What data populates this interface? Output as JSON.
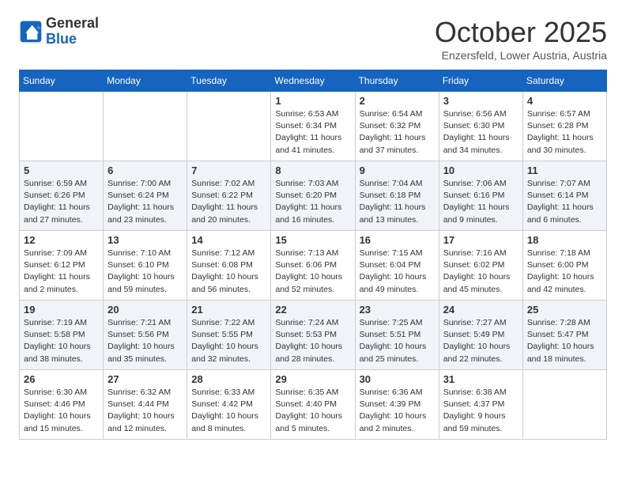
{
  "header": {
    "logo_general": "General",
    "logo_blue": "Blue",
    "month": "October 2025",
    "location": "Enzersfeld, Lower Austria, Austria"
  },
  "weekdays": [
    "Sunday",
    "Monday",
    "Tuesday",
    "Wednesday",
    "Thursday",
    "Friday",
    "Saturday"
  ],
  "weeks": [
    [
      {
        "day": "",
        "info": ""
      },
      {
        "day": "",
        "info": ""
      },
      {
        "day": "",
        "info": ""
      },
      {
        "day": "1",
        "info": "Sunrise: 6:53 AM\nSunset: 6:34 PM\nDaylight: 11 hours\nand 41 minutes."
      },
      {
        "day": "2",
        "info": "Sunrise: 6:54 AM\nSunset: 6:32 PM\nDaylight: 11 hours\nand 37 minutes."
      },
      {
        "day": "3",
        "info": "Sunrise: 6:56 AM\nSunset: 6:30 PM\nDaylight: 11 hours\nand 34 minutes."
      },
      {
        "day": "4",
        "info": "Sunrise: 6:57 AM\nSunset: 6:28 PM\nDaylight: 11 hours\nand 30 minutes."
      }
    ],
    [
      {
        "day": "5",
        "info": "Sunrise: 6:59 AM\nSunset: 6:26 PM\nDaylight: 11 hours\nand 27 minutes."
      },
      {
        "day": "6",
        "info": "Sunrise: 7:00 AM\nSunset: 6:24 PM\nDaylight: 11 hours\nand 23 minutes."
      },
      {
        "day": "7",
        "info": "Sunrise: 7:02 AM\nSunset: 6:22 PM\nDaylight: 11 hours\nand 20 minutes."
      },
      {
        "day": "8",
        "info": "Sunrise: 7:03 AM\nSunset: 6:20 PM\nDaylight: 11 hours\nand 16 minutes."
      },
      {
        "day": "9",
        "info": "Sunrise: 7:04 AM\nSunset: 6:18 PM\nDaylight: 11 hours\nand 13 minutes."
      },
      {
        "day": "10",
        "info": "Sunrise: 7:06 AM\nSunset: 6:16 PM\nDaylight: 11 hours\nand 9 minutes."
      },
      {
        "day": "11",
        "info": "Sunrise: 7:07 AM\nSunset: 6:14 PM\nDaylight: 11 hours\nand 6 minutes."
      }
    ],
    [
      {
        "day": "12",
        "info": "Sunrise: 7:09 AM\nSunset: 6:12 PM\nDaylight: 11 hours\nand 2 minutes."
      },
      {
        "day": "13",
        "info": "Sunrise: 7:10 AM\nSunset: 6:10 PM\nDaylight: 10 hours\nand 59 minutes."
      },
      {
        "day": "14",
        "info": "Sunrise: 7:12 AM\nSunset: 6:08 PM\nDaylight: 10 hours\nand 56 minutes."
      },
      {
        "day": "15",
        "info": "Sunrise: 7:13 AM\nSunset: 6:06 PM\nDaylight: 10 hours\nand 52 minutes."
      },
      {
        "day": "16",
        "info": "Sunrise: 7:15 AM\nSunset: 6:04 PM\nDaylight: 10 hours\nand 49 minutes."
      },
      {
        "day": "17",
        "info": "Sunrise: 7:16 AM\nSunset: 6:02 PM\nDaylight: 10 hours\nand 45 minutes."
      },
      {
        "day": "18",
        "info": "Sunrise: 7:18 AM\nSunset: 6:00 PM\nDaylight: 10 hours\nand 42 minutes."
      }
    ],
    [
      {
        "day": "19",
        "info": "Sunrise: 7:19 AM\nSunset: 5:58 PM\nDaylight: 10 hours\nand 38 minutes."
      },
      {
        "day": "20",
        "info": "Sunrise: 7:21 AM\nSunset: 5:56 PM\nDaylight: 10 hours\nand 35 minutes."
      },
      {
        "day": "21",
        "info": "Sunrise: 7:22 AM\nSunset: 5:55 PM\nDaylight: 10 hours\nand 32 minutes."
      },
      {
        "day": "22",
        "info": "Sunrise: 7:24 AM\nSunset: 5:53 PM\nDaylight: 10 hours\nand 28 minutes."
      },
      {
        "day": "23",
        "info": "Sunrise: 7:25 AM\nSunset: 5:51 PM\nDaylight: 10 hours\nand 25 minutes."
      },
      {
        "day": "24",
        "info": "Sunrise: 7:27 AM\nSunset: 5:49 PM\nDaylight: 10 hours\nand 22 minutes."
      },
      {
        "day": "25",
        "info": "Sunrise: 7:28 AM\nSunset: 5:47 PM\nDaylight: 10 hours\nand 18 minutes."
      }
    ],
    [
      {
        "day": "26",
        "info": "Sunrise: 6:30 AM\nSunset: 4:46 PM\nDaylight: 10 hours\nand 15 minutes."
      },
      {
        "day": "27",
        "info": "Sunrise: 6:32 AM\nSunset: 4:44 PM\nDaylight: 10 hours\nand 12 minutes."
      },
      {
        "day": "28",
        "info": "Sunrise: 6:33 AM\nSunset: 4:42 PM\nDaylight: 10 hours\nand 8 minutes."
      },
      {
        "day": "29",
        "info": "Sunrise: 6:35 AM\nSunset: 4:40 PM\nDaylight: 10 hours\nand 5 minutes."
      },
      {
        "day": "30",
        "info": "Sunrise: 6:36 AM\nSunset: 4:39 PM\nDaylight: 10 hours\nand 2 minutes."
      },
      {
        "day": "31",
        "info": "Sunrise: 6:38 AM\nSunset: 4:37 PM\nDaylight: 9 hours\nand 59 minutes."
      },
      {
        "day": "",
        "info": ""
      }
    ]
  ]
}
